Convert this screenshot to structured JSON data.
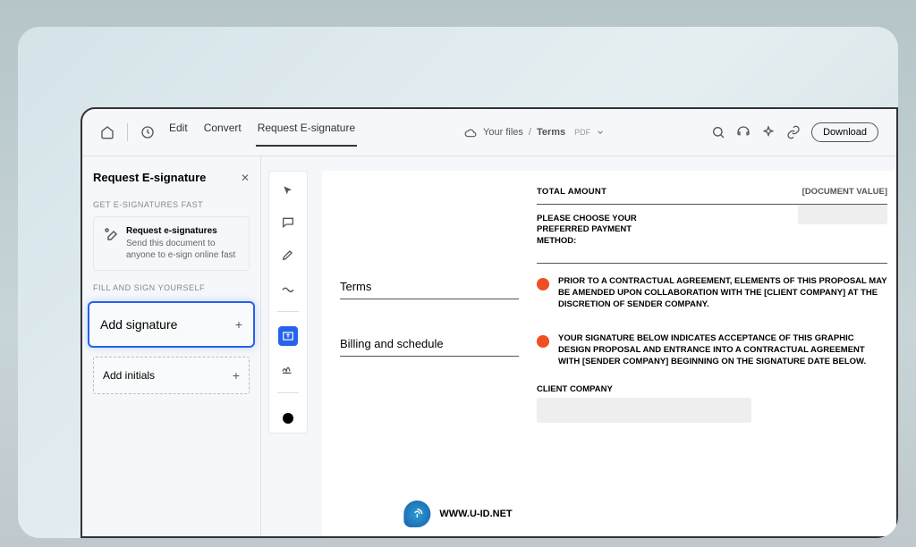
{
  "toolbar": {
    "tabs": [
      "Edit",
      "Convert",
      "Request E-signature"
    ],
    "breadcrumb": {
      "folder": "Your files",
      "file": "Terms",
      "type": "PDF"
    },
    "download": "Download"
  },
  "sidebar": {
    "title": "Request E-signature",
    "section1_label": "GET E-SIGNATURES FAST",
    "infocard": {
      "title": "Request e-signatures",
      "desc": "Send this document to anyone to e-sign online fast"
    },
    "section2_label": "FILL AND SIGN YOURSELF",
    "add_signature": "Add signature",
    "add_initials": "Add initials"
  },
  "doc": {
    "total_label": "TOTAL AMOUNT",
    "total_value": "[DOCUMENT VALUE]",
    "payment_text": "PLEASE CHOOSE YOUR PREFERRED PAYMENT METHOD:",
    "heading1": "Terms",
    "para1": "PRIOR TO A CONTRACTUAL AGREEMENT, ELEMENTS OF THIS PROPOSAL MAY BE AMENDED UPON COLLABORATION WITH THE [CLIENT COMPANY] AT THE DISCRETION OF SENDER COMPANY.",
    "heading2": "Billing and schedule",
    "para2": "YOUR SIGNATURE BELOW INDICATES ACCEPTANCE OF THIS GRAPHIC DESIGN PROPOSAL AND ENTRANCE INTO A CONTRACTUAL AGREEMENT WITH [SENDER COMPANY] BEGINNING ON THE SIGNATURE DATE BELOW.",
    "client_label": "CLIENT COMPANY"
  },
  "footer": "WWW.U-ID.NET"
}
